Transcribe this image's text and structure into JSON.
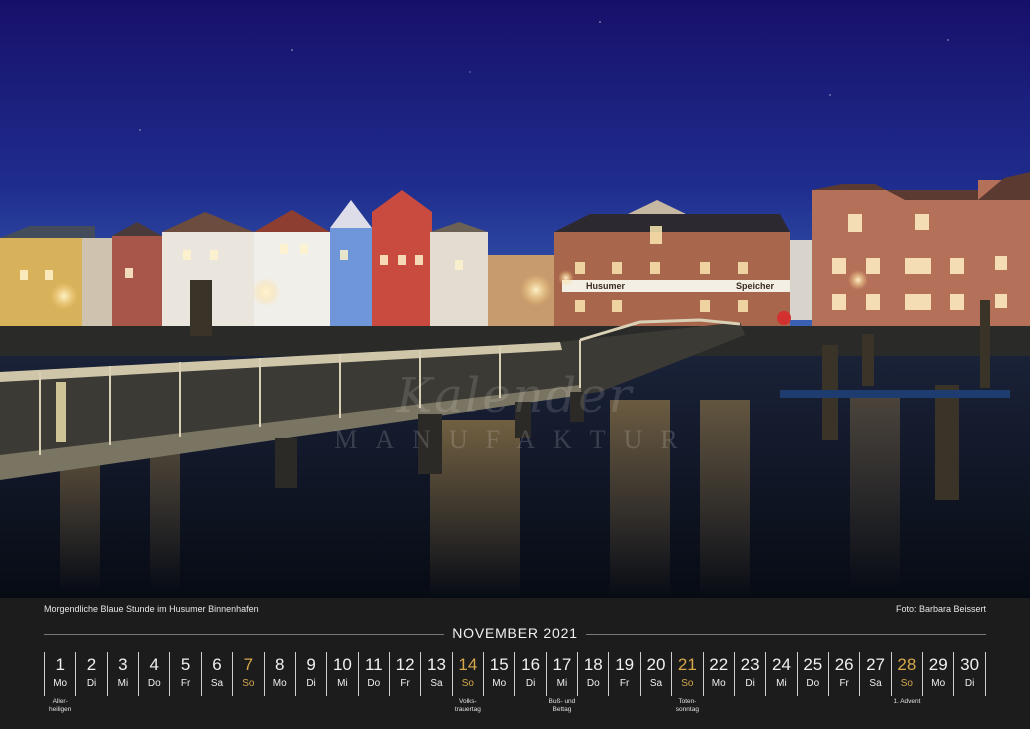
{
  "photo": {
    "sign_left": "Husumer",
    "sign_right": "Speicher"
  },
  "watermark": {
    "line1": "Kalender",
    "line2": "MANUFAKTUR"
  },
  "caption": "Morgendliche Blaue Stunde im Husumer Binnenhafen",
  "credit": "Foto: Barbara Beissert",
  "month_title": "NOVEMBER 2021",
  "colors": {
    "sky_top": "#1a0f6e",
    "sky_bottom": "#3a63b8",
    "water": "#0d1422",
    "sunday": "#d6a84a",
    "footer_bg": "#1c1c1c"
  },
  "days": [
    {
      "num": "1",
      "wd": "Mo",
      "note": "Aller-\nheiligen"
    },
    {
      "num": "2",
      "wd": "Di",
      "note": ""
    },
    {
      "num": "3",
      "wd": "Mi",
      "note": ""
    },
    {
      "num": "4",
      "wd": "Do",
      "note": ""
    },
    {
      "num": "5",
      "wd": "Fr",
      "note": ""
    },
    {
      "num": "6",
      "wd": "Sa",
      "note": ""
    },
    {
      "num": "7",
      "wd": "So",
      "note": ""
    },
    {
      "num": "8",
      "wd": "Mo",
      "note": ""
    },
    {
      "num": "9",
      "wd": "Di",
      "note": ""
    },
    {
      "num": "10",
      "wd": "Mi",
      "note": ""
    },
    {
      "num": "11",
      "wd": "Do",
      "note": ""
    },
    {
      "num": "12",
      "wd": "Fr",
      "note": ""
    },
    {
      "num": "13",
      "wd": "Sa",
      "note": ""
    },
    {
      "num": "14",
      "wd": "So",
      "note": "Volks-\ntrauertag"
    },
    {
      "num": "15",
      "wd": "Mo",
      "note": ""
    },
    {
      "num": "16",
      "wd": "Di",
      "note": ""
    },
    {
      "num": "17",
      "wd": "Mi",
      "note": "Buß- und\nBettag"
    },
    {
      "num": "18",
      "wd": "Do",
      "note": ""
    },
    {
      "num": "19",
      "wd": "Fr",
      "note": ""
    },
    {
      "num": "20",
      "wd": "Sa",
      "note": ""
    },
    {
      "num": "21",
      "wd": "So",
      "note": "Toten-\nsonntag"
    },
    {
      "num": "22",
      "wd": "Mo",
      "note": ""
    },
    {
      "num": "23",
      "wd": "Di",
      "note": ""
    },
    {
      "num": "24",
      "wd": "Mi",
      "note": ""
    },
    {
      "num": "25",
      "wd": "Do",
      "note": ""
    },
    {
      "num": "26",
      "wd": "Fr",
      "note": ""
    },
    {
      "num": "27",
      "wd": "Sa",
      "note": ""
    },
    {
      "num": "28",
      "wd": "So",
      "note": "1. Advent"
    },
    {
      "num": "29",
      "wd": "Mo",
      "note": ""
    },
    {
      "num": "30",
      "wd": "Di",
      "note": ""
    }
  ]
}
